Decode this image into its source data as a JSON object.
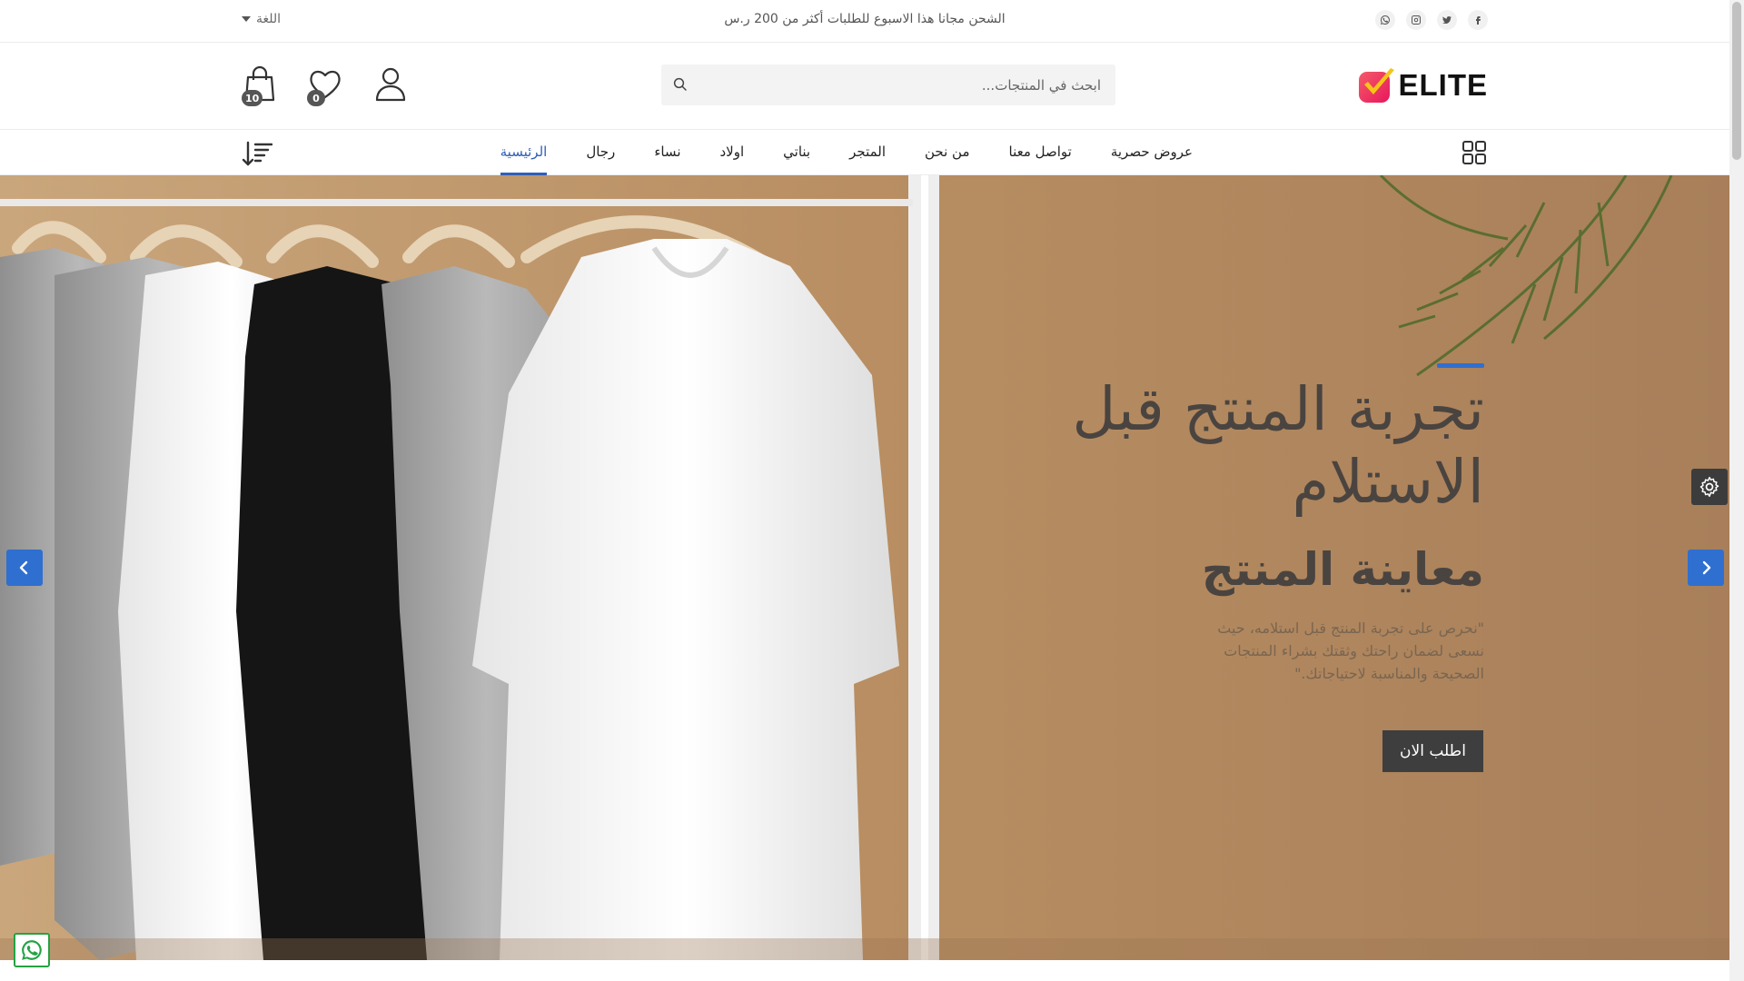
{
  "topbar": {
    "promo": "الشحن مجانا هذا الاسبوع للطلبات أكثر من 200 ر.س",
    "language": "اللغة",
    "socials": [
      "facebook-icon",
      "twitter-icon",
      "instagram-icon",
      "whatsapp-icon"
    ]
  },
  "header": {
    "logo_text": "ELITE",
    "search_placeholder": "ابحث في المنتجات...",
    "wishlist_count": "0",
    "cart_count": "10"
  },
  "nav": {
    "items": [
      {
        "label": "الرئيسية",
        "active": true
      },
      {
        "label": "رجال"
      },
      {
        "label": "نساء"
      },
      {
        "label": "اولاد"
      },
      {
        "label": "بناتي"
      },
      {
        "label": "المتجر"
      },
      {
        "label": "من نحن"
      },
      {
        "label": "تواصل معنا"
      },
      {
        "label": "عروض حصرية"
      }
    ]
  },
  "hero": {
    "title": "تجربة المنتج قبل الاستلام",
    "subtitle": "معاينة المنتج",
    "description": "\"نحرص على تجربة المنتج قبل استلامه، حيث نسعى لضمان راحتك وثقتك بشراء المنتجات الصحيحة والمناسبة لاحتياجاتك.\"",
    "button": "اطلب الان"
  },
  "colors": {
    "accent": "#2f6fcf",
    "nav_active": "#2f5fb8",
    "button_dark": "#3e3e3e",
    "hero_bg": "#b98f63"
  }
}
